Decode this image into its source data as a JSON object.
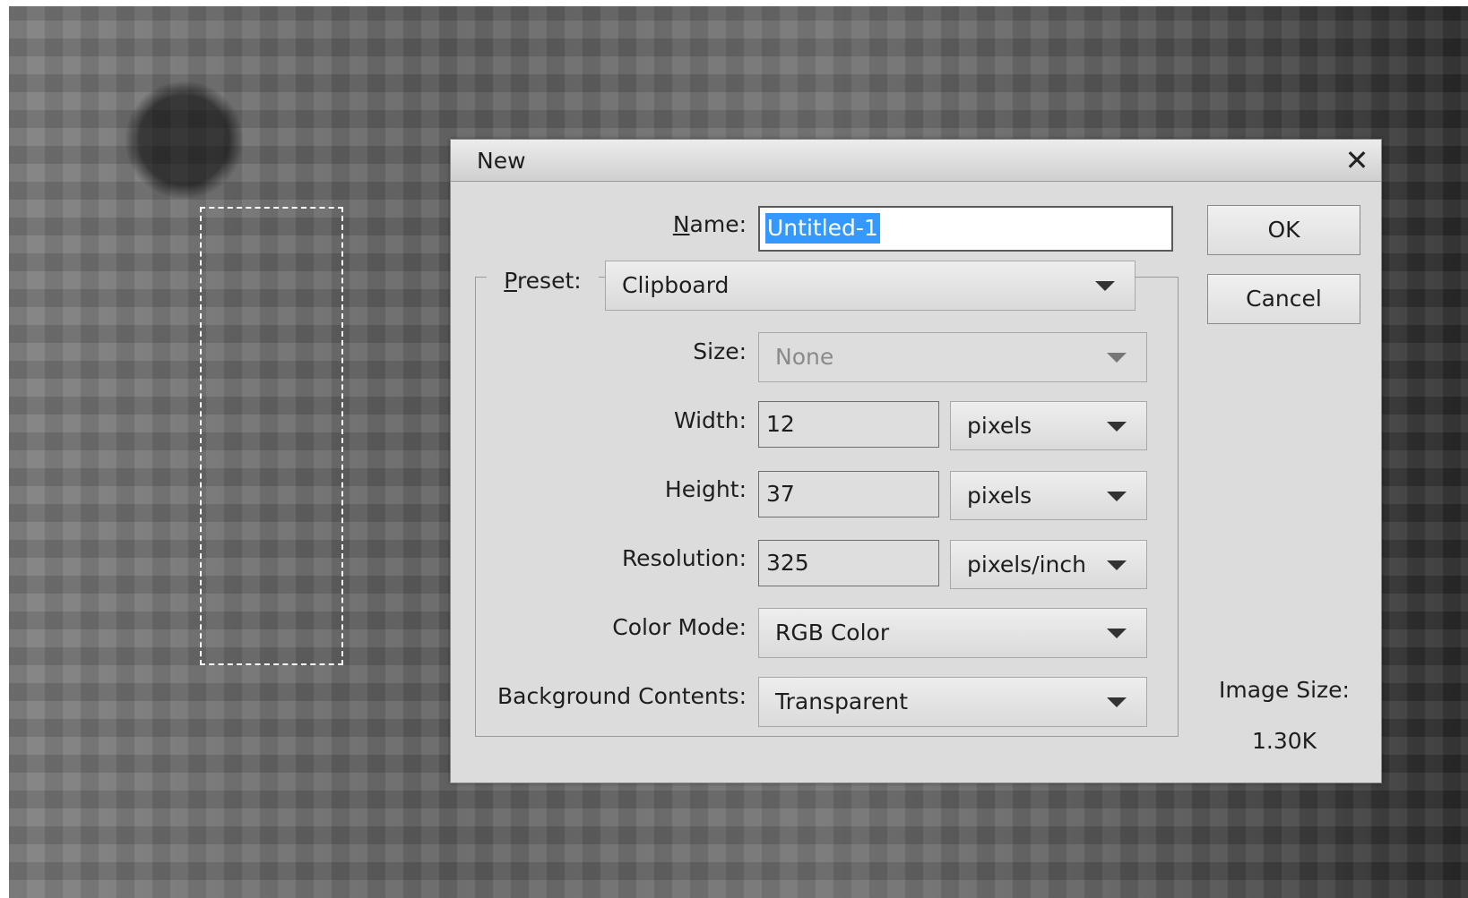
{
  "dialog": {
    "title": "New",
    "close_icon": "close-icon",
    "name": {
      "label_prefix": "N",
      "label_rest": "ame:",
      "value": "Untitled-1"
    },
    "preset": {
      "label_prefix": "P",
      "label_rest": "reset:",
      "value": "Clipboard"
    },
    "size": {
      "label": "Size:",
      "value": "None",
      "enabled": false
    },
    "width": {
      "label": "Width:",
      "value": "12",
      "unit": "pixels"
    },
    "height": {
      "label": "Height:",
      "value": "37",
      "unit": "pixels"
    },
    "resolution": {
      "label": "Resolution:",
      "value": "325",
      "unit": "pixels/inch"
    },
    "color_mode": {
      "label": "Color Mode:",
      "value": "RGB Color"
    },
    "background_contents": {
      "label": "Background Contents:",
      "value": "Transparent"
    },
    "buttons": {
      "ok": "OK",
      "cancel": "Cancel"
    },
    "image_size": {
      "label": "Image Size:",
      "value": "1.30K"
    }
  },
  "colors": {
    "selection_highlight": "#3399ff",
    "dialog_bg": "#dcdcdc"
  }
}
